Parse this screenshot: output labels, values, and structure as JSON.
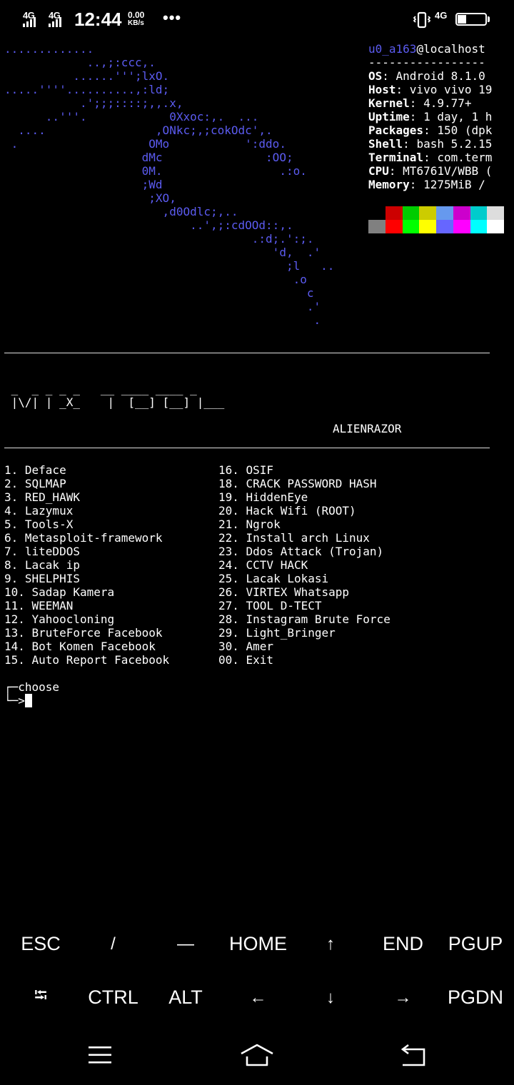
{
  "status_bar": {
    "network1": "4G",
    "network2": "4G",
    "time": "12:44",
    "speed_value": "0.00",
    "speed_unit": "KB/s",
    "more": "•••",
    "network_right": "4G",
    "battery": "31",
    "battery_level": 0.31,
    "icons": [
      "signal-icon",
      "vibrate-icon",
      "battery-icon"
    ]
  },
  "terminal": {
    "ascii_art": [
      ".............",
      "            ..,;:ccc,.",
      "          ......''';lxO.",
      ".....''''..........,:ld;",
      "           .';;;::::;,,.x,",
      "      ..'''.            0Xxoc:,.  ...",
      "  ....                ,ONkc;,;cokOdc',.",
      " .                   OMo           ':ddo.",
      "                    dMc               :OO;",
      "                    0M.                 .:o.",
      "                    ;Wd",
      "                     ;XO,",
      "                       ,d0Odlc;,..",
      "                           ..',;:cdOOd::,.",
      "                                    .:d;.':;.",
      "                                       'd,  .'",
      "                                         ;l   ..",
      "                                          .o",
      "                                            c",
      "                                            .'",
      "                                             ."
    ],
    "info": {
      "user": "u0_a163",
      "host": "@localhost",
      "separator": "-----------------",
      "rows": [
        {
          "key": "OS",
          "value": ": Android 8.1.0"
        },
        {
          "key": "Host",
          "value": ": vivo vivo 19"
        },
        {
          "key": "Kernel",
          "value": ": 4.9.77+"
        },
        {
          "key": "Uptime",
          "value": ": 1 day, 1 h"
        },
        {
          "key": "Packages",
          "value": ": 150 (dpk"
        },
        {
          "key": "Shell",
          "value": ": bash 5.2.15"
        },
        {
          "key": "Terminal",
          "value": ": com.term"
        },
        {
          "key": "CPU",
          "value": ": MT6761V/WBB ("
        },
        {
          "key": "Memory",
          "value": ": 1275MiB /"
        }
      ],
      "palette_row1": [
        "#000000",
        "#cc0000",
        "#00cc00",
        "#cccc00",
        "#6699ee",
        "#cc00cc",
        "#00cccc",
        "#dddddd"
      ],
      "palette_row2": [
        "#808080",
        "#ff0000",
        "#00ff00",
        "#ffff00",
        "#6666ff",
        "#ff00ff",
        "#00ffff",
        "#ffffff"
      ]
    },
    "banner": [
      " _  _ _ _ _   __ ____ ____ _",
      " |\\/| | _X_    |  [__] [__] |___"
    ],
    "brand": "ALIENRAZOR",
    "menu_left": [
      "1. Deface",
      "2. SQLMAP",
      "3. RED_HAWK",
      "4. Lazymux",
      "5. Tools-X",
      "6. Metasploit-framework",
      "7. liteDDOS",
      "8. Lacak ip",
      "9. SHELPHIS",
      "10. Sadap Kamera",
      "11. WEEMAN",
      "12. Yahoocloning",
      "13. BruteForce Facebook",
      "14. Bot Komen Facebook",
      "15. Auto Report Facebook"
    ],
    "menu_right": [
      "16. OSIF",
      "18. CRACK PASSWORD HASH",
      "19. HiddenEye",
      "20. Hack Wifi (ROOT)",
      "21. Ngrok",
      "22. Install arch Linux",
      "23. Ddos Attack (Trojan)",
      "24. CCTV HACK",
      "25. Lacak Lokasi",
      "26. VIRTEX Whatsapp",
      "27. TOOL D-TECT",
      "28. Instagram Brute Force",
      "29. Light_Bringer",
      "30. Amer",
      "00. Exit"
    ],
    "prompt_line1": "┌─choose",
    "prompt_line2": "└─>"
  },
  "extra_keys": {
    "row1": [
      "ESC",
      "/",
      "—",
      "HOME",
      "↑",
      "END",
      "PGUP"
    ],
    "row2": [
      "⭾",
      "CTRL",
      "ALT",
      "←",
      "↓",
      "→",
      "PGDN"
    ]
  },
  "nav": {
    "icons": [
      "menu-icon",
      "home-icon",
      "back-icon"
    ]
  }
}
